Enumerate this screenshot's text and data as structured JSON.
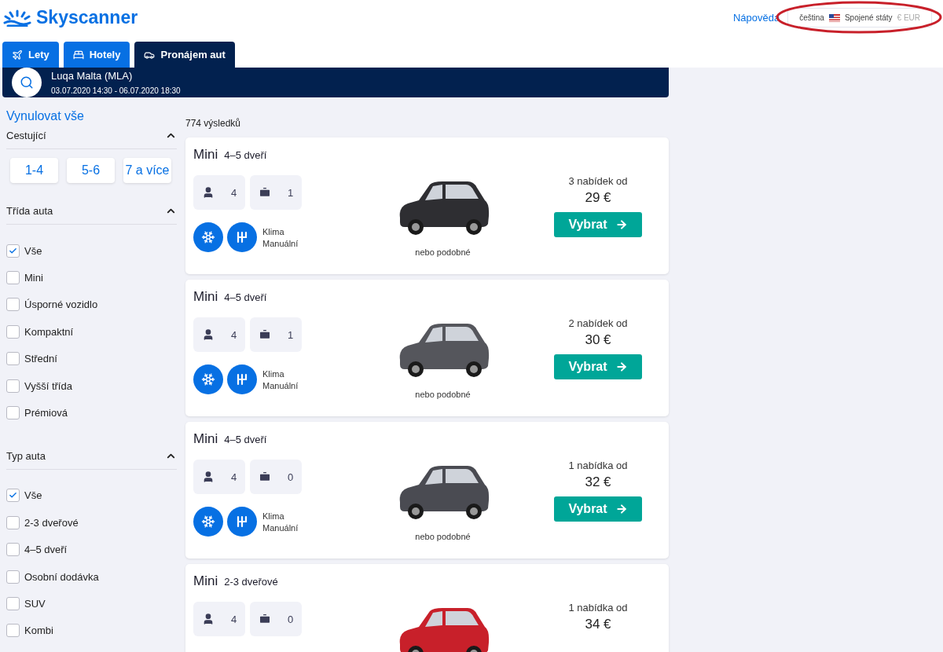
{
  "header": {
    "logo": "Skyscanner",
    "help": "Nápověda",
    "language": "čeština",
    "country": "Spojené státy",
    "currency": "€ EUR"
  },
  "tabs": [
    {
      "label": "Lety",
      "selected": false
    },
    {
      "label": "Hotely",
      "selected": false
    },
    {
      "label": "Pronájem aut",
      "selected": true
    }
  ],
  "search": {
    "location": "Luqa Malta (MLA)",
    "dates": "03.07.2020 14:30 - 06.07.2020 18:30"
  },
  "sidebar": {
    "reset": "Vynulovat vše",
    "sections": [
      {
        "title": "Cestující",
        "kind": "buttons",
        "expanded": true,
        "options": [
          {
            "label": "1-4"
          },
          {
            "label": "5-6"
          },
          {
            "label": "7 a více"
          }
        ]
      },
      {
        "title": "Třída auta",
        "kind": "checkboxes",
        "expanded": true,
        "options": [
          {
            "label": "Vše",
            "checked": true
          },
          {
            "label": "Mini",
            "checked": false
          },
          {
            "label": "Úsporné vozidlo",
            "checked": false
          },
          {
            "label": "Kompaktní",
            "checked": false
          },
          {
            "label": "Střední",
            "checked": false
          },
          {
            "label": "Vyšší třída",
            "checked": false
          },
          {
            "label": "Prémiová",
            "checked": false
          }
        ]
      },
      {
        "title": "Typ auta",
        "kind": "checkboxes",
        "expanded": true,
        "options": [
          {
            "label": "Vše",
            "checked": true
          },
          {
            "label": "2-3 dveřové",
            "checked": false
          },
          {
            "label": "4–5 dveří",
            "checked": false
          },
          {
            "label": "Osobní dodávka",
            "checked": false
          },
          {
            "label": "SUV",
            "checked": false
          },
          {
            "label": "Kombi",
            "checked": false
          }
        ]
      }
    ]
  },
  "results": {
    "count": "774 výsledků",
    "cards": [
      {
        "category": "Mini",
        "doors": "4–5 dveří",
        "passengers": "4",
        "bags": "1",
        "color": "#2e2e32",
        "features": [
          {
            "kind": "ac",
            "label": "Klima"
          },
          {
            "kind": "manual",
            "label": "Manuální"
          }
        ],
        "similar": "nebo podobné",
        "offers": "3 nabídek od",
        "price": "29 €",
        "button": "Vybrat"
      },
      {
        "category": "Mini",
        "doors": "4–5 dveří",
        "passengers": "4",
        "bags": "1",
        "color": "#55565c",
        "features": [
          {
            "kind": "ac",
            "label": "Klima"
          },
          {
            "kind": "manual",
            "label": "Manuální"
          }
        ],
        "similar": "nebo podobné",
        "offers": "2 nabídek od",
        "price": "30 €",
        "button": "Vybrat"
      },
      {
        "category": "Mini",
        "doors": "4–5 dveří",
        "passengers": "4",
        "bags": "0",
        "color": "#4a4b52",
        "features": [
          {
            "kind": "ac",
            "label": "Klima"
          },
          {
            "kind": "manual",
            "label": "Manuální"
          }
        ],
        "similar": "nebo podobné",
        "offers": "1 nabídka od",
        "price": "32 €",
        "button": "Vybrat"
      },
      {
        "category": "Mini",
        "doors": "2-3 dveřové",
        "passengers": "4",
        "bags": "0",
        "color": "#c8202a",
        "offers": "1 nabídka od",
        "price": "34 €"
      }
    ]
  }
}
